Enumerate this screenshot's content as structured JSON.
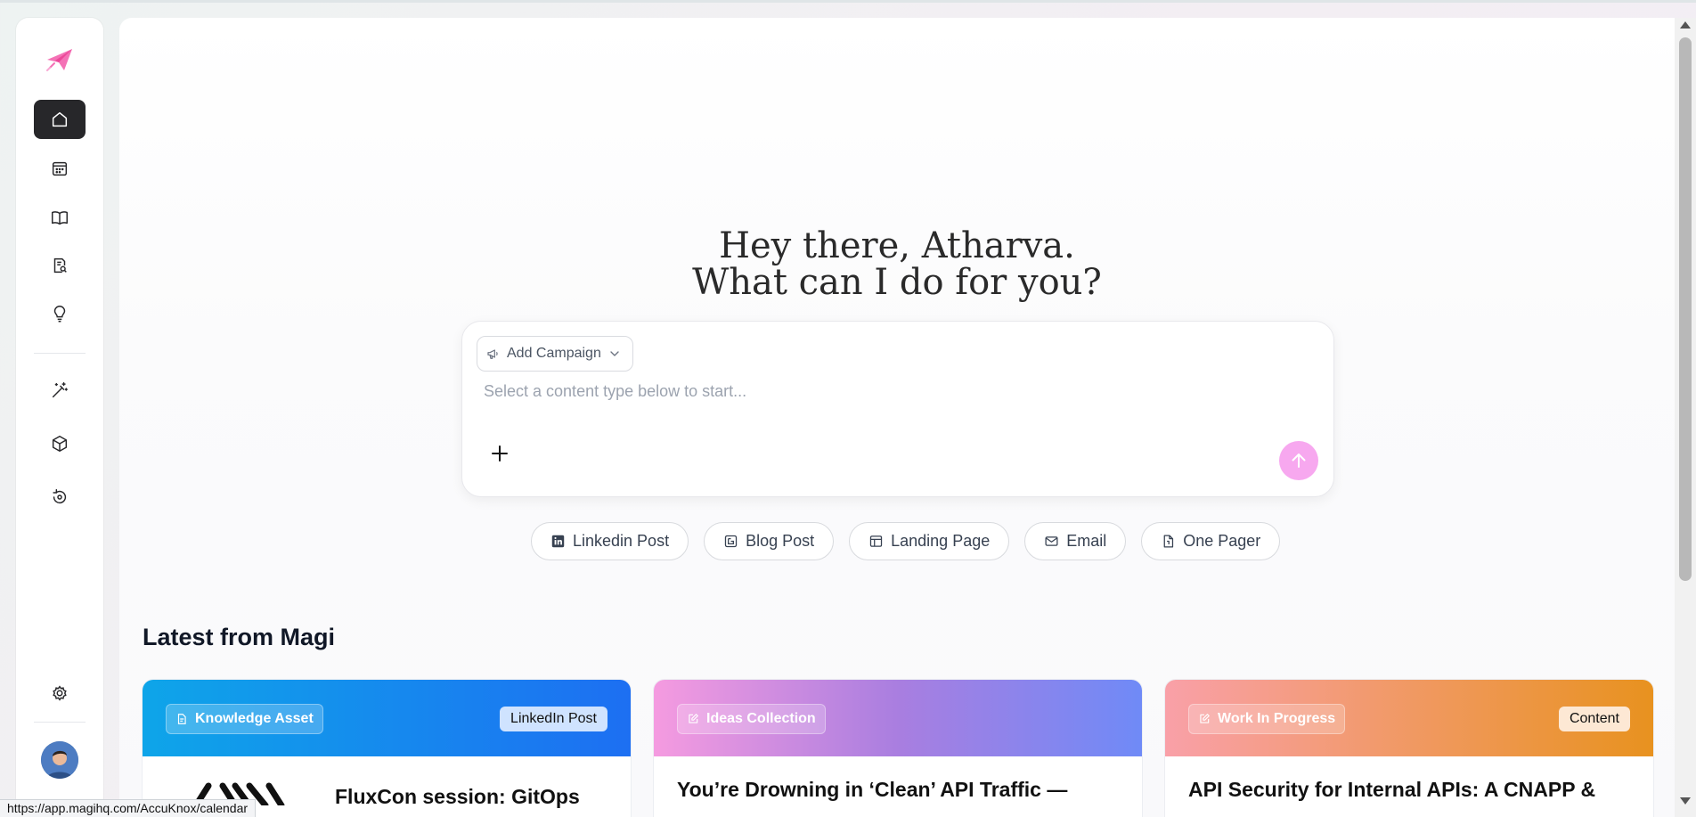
{
  "app": {
    "greeting_line1": "Hey there, Atharva.",
    "greeting_line2": "What can I do for you?"
  },
  "sidebar": {
    "items": [
      {
        "name": "home",
        "icon": "home-icon",
        "active": true
      },
      {
        "name": "calendar",
        "icon": "calendar-icon",
        "active": false
      },
      {
        "name": "library",
        "icon": "book-open-icon",
        "active": false
      },
      {
        "name": "reviews",
        "icon": "document-search-icon",
        "active": false
      },
      {
        "name": "ideas",
        "icon": "lightbulb-icon",
        "active": false
      },
      {
        "name": "magic",
        "icon": "magic-wand-icon",
        "active": false
      },
      {
        "name": "products",
        "icon": "cube-icon",
        "active": false
      },
      {
        "name": "history",
        "icon": "history-icon",
        "active": false
      }
    ],
    "settings_icon": "gear-icon",
    "accent": "#27272a"
  },
  "composer": {
    "campaign_label": "Add Campaign",
    "placeholder": "Select a content type below to start...",
    "send_color": "#f7a8ef"
  },
  "content_types": [
    {
      "label": "Linkedin Post",
      "icon": "linkedin-icon"
    },
    {
      "label": "Blog Post",
      "icon": "blog-icon"
    },
    {
      "label": "Landing Page",
      "icon": "layout-icon"
    },
    {
      "label": "Email",
      "icon": "mail-icon"
    },
    {
      "label": "One Pager",
      "icon": "file-icon"
    }
  ],
  "latest": {
    "title": "Latest from Magi",
    "cards": [
      {
        "tag": "Knowledge Asset",
        "badge": "LinkedIn Post",
        "title": "FluxCon session: GitOps",
        "colors": [
          "#0ea5e9",
          "#1d6ff2"
        ],
        "badge_bg": "#cfe3ff"
      },
      {
        "tag": "Ideas Collection",
        "badge": "",
        "title": "You’re Drowning in ‘Clean’ API Traffic —",
        "colors": [
          "#f59be0",
          "#6f8af7"
        ],
        "badge_bg": ""
      },
      {
        "tag": "Work In Progress",
        "badge": "Content",
        "title": "API Security for Internal APIs: A CNAPP &",
        "colors": [
          "#f9a0a8",
          "#e8921f"
        ],
        "badge_bg": "#fde8d4"
      }
    ]
  },
  "status_bar": {
    "url": "https://app.magihq.com/AccuKnox/calendar"
  }
}
